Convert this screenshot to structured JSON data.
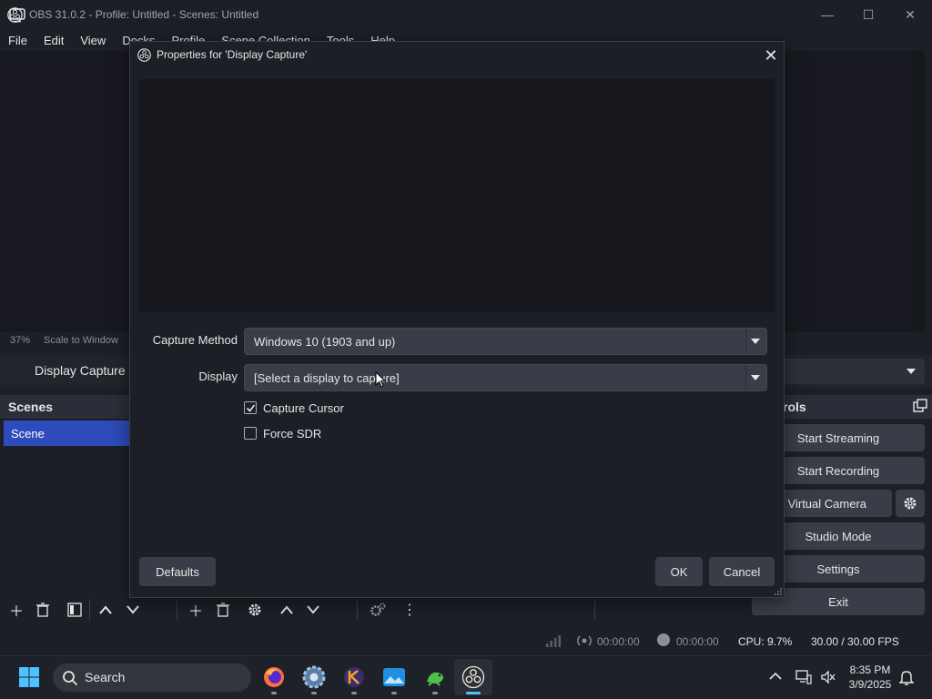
{
  "window": {
    "title": "OBS 31.0.2 - Profile: Untitled - Scenes: Untitled",
    "minimize": "—",
    "maximize": "☐",
    "close": "✕"
  },
  "menu": [
    "File",
    "Edit",
    "View",
    "Docks",
    "Profile",
    "Scene Collection",
    "Tools",
    "Help"
  ],
  "preview_status": {
    "zoom": "37%",
    "scale": "Scale to Window"
  },
  "source_bar": {
    "label": "Display Capture"
  },
  "scenes": {
    "header": "Scenes",
    "items": [
      "Scene"
    ]
  },
  "controls": {
    "header": "rols",
    "buttons": {
      "start_streaming": "Start Streaming",
      "start_recording": "Start Recording",
      "start_virtual_camera": "rt Virtual Camera",
      "studio_mode": "Studio Mode",
      "settings": "Settings",
      "exit": "Exit"
    }
  },
  "statusbar": {
    "stream_time": "00:00:00",
    "record_time": "00:00:00",
    "cpu": "CPU: 9.7%",
    "fps": "30.00 / 30.00 FPS"
  },
  "dialog": {
    "title": "Properties for 'Display Capture'",
    "capture_method": {
      "label": "Capture Method",
      "value": "Windows 10 (1903 and up)"
    },
    "display": {
      "label": "Display",
      "value": "[Select a display to capture]"
    },
    "capture_cursor": {
      "label": "Capture Cursor",
      "checked": true
    },
    "force_sdr": {
      "label": "Force SDR",
      "checked": false
    },
    "defaults_button": "Defaults",
    "ok_button": "OK",
    "cancel_button": "Cancel"
  },
  "taskbar": {
    "search_placeholder": "Search",
    "time": "8:35 PM",
    "date": "3/9/2025",
    "apps": [
      "firefox-icon",
      "chrome-settings-icon",
      "krita-icon",
      "photos-icon",
      "gecko-icon",
      "obs-icon"
    ]
  },
  "colors": {
    "accent": "#2d4bba",
    "taskbar_active": "#4cc2ff",
    "background": "#1d1f26",
    "button": "#3a3d47"
  }
}
